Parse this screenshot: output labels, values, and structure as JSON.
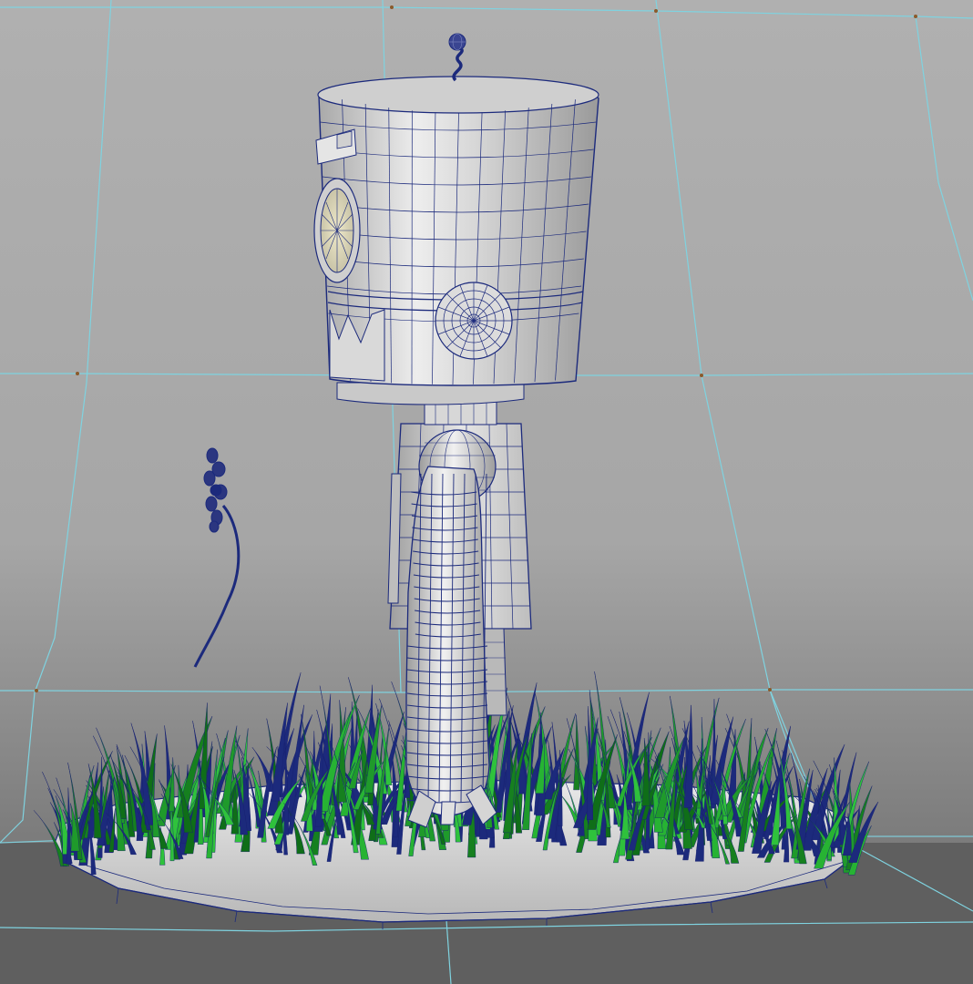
{
  "viewport": {
    "background_top": "#a9a9a9",
    "background_bottom": "#6f6f6f",
    "floor_color": "#5d5d5d"
  },
  "colors": {
    "ground_grid": "#7fd3e0",
    "wireframe": "#1c2a7c",
    "shaded_surface": "#d4d4d4",
    "shaded_highlight": "#f2f2f2",
    "shaded_shadow": "#8c8c8c",
    "grass": "#1f9a2b",
    "grass_wire": "#16206e"
  },
  "scene": {
    "objects": [
      {
        "name": "robot-head",
        "icon": "cylinder-mesh"
      },
      {
        "name": "antenna",
        "icon": "spring-mesh"
      },
      {
        "name": "robot-body",
        "icon": "tapered-box-mesh"
      },
      {
        "name": "robot-arm",
        "icon": "segmented-tube-mesh"
      },
      {
        "name": "flower",
        "icon": "curve-mesh"
      },
      {
        "name": "grass-patch",
        "icon": "hair-system"
      },
      {
        "name": "base-plate",
        "icon": "disc-mesh"
      }
    ]
  }
}
